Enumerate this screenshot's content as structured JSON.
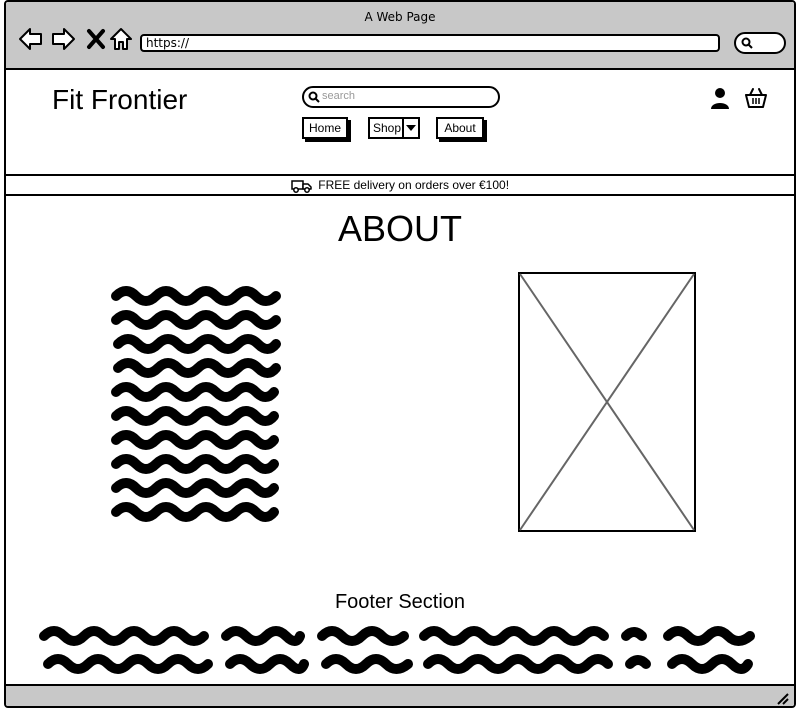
{
  "browser": {
    "window_title": "A Web Page",
    "url": "https://"
  },
  "site": {
    "title": "Fit Frontier",
    "search_placeholder": "search",
    "nav": {
      "home": "Home",
      "shop": "Shop",
      "about": "About"
    }
  },
  "banner": {
    "text": "FREE delivery on orders over €100!"
  },
  "main": {
    "heading": "ABOUT"
  },
  "footer": {
    "heading": "Footer Section"
  }
}
